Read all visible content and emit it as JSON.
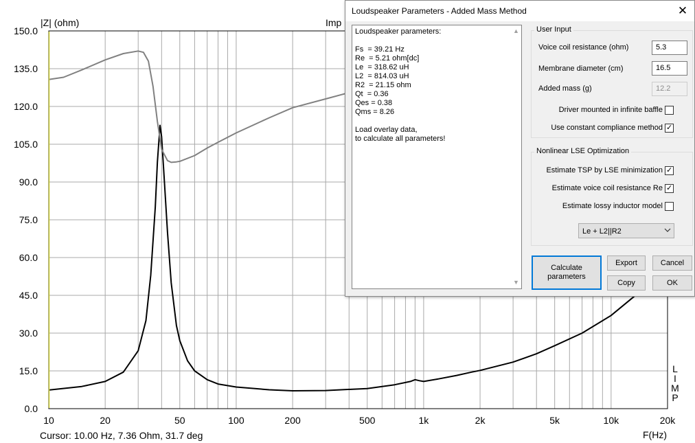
{
  "chart_data": {
    "type": "line",
    "ylabel": "|Z| (ohm)",
    "title_visible": "Imp",
    "xlabel": "F(Hz)",
    "x_scale": "log",
    "xlim": [
      10,
      20000
    ],
    "ylim": [
      0,
      150
    ],
    "x_ticks": [
      {
        "v": 10,
        "label": "10"
      },
      {
        "v": 20,
        "label": "20"
      },
      {
        "v": 50,
        "label": "50"
      },
      {
        "v": 100,
        "label": "100"
      },
      {
        "v": 200,
        "label": "200"
      },
      {
        "v": 500,
        "label": "500"
      },
      {
        "v": 1000,
        "label": "1k"
      },
      {
        "v": 2000,
        "label": "2k"
      },
      {
        "v": 5000,
        "label": "5k"
      },
      {
        "v": 10000,
        "label": "10k"
      },
      {
        "v": 20000,
        "label": "20k"
      }
    ],
    "y_ticks": [
      "0.0",
      "15.0",
      "30.0",
      "45.0",
      "60.0",
      "75.0",
      "90.0",
      "105.0",
      "120.0",
      "135.0",
      "150.0"
    ],
    "grid": true,
    "cursor_x": 10,
    "right_label": [
      "L",
      "I",
      "M",
      "P"
    ],
    "series": [
      {
        "color": "#000000",
        "x": [
          10,
          15,
          20,
          25,
          30,
          33,
          35,
          37,
          38,
          39.21,
          40,
          41,
          43,
          45,
          48,
          50,
          55,
          60,
          70,
          80,
          100,
          150,
          200,
          300,
          500,
          700,
          850,
          900,
          950,
          1000,
          1200,
          1500,
          1800,
          2000,
          3000,
          4000,
          5000,
          7000,
          10000,
          13000,
          14000,
          15000
        ],
        "y": [
          7.4,
          8.8,
          10.8,
          14.5,
          23,
          35,
          53,
          80,
          98,
          112.5,
          108,
          95,
          70,
          50,
          33,
          27,
          19,
          15,
          11.5,
          9.8,
          8.6,
          7.5,
          7.1,
          7.2,
          8,
          9.5,
          10.8,
          11.5,
          11.1,
          10.8,
          11.8,
          13.2,
          14.5,
          15.2,
          18.5,
          21.8,
          25,
          30,
          37,
          44,
          46,
          48
        ]
      },
      {
        "color": "#808080",
        "x": [
          10,
          12,
          15,
          20,
          25,
          30,
          32,
          34,
          36,
          38,
          40,
          43,
          45,
          48,
          50,
          60,
          70,
          80,
          100,
          150,
          200,
          300,
          400,
          500
        ],
        "y": [
          130.7,
          131.6,
          134.5,
          138.5,
          141,
          142,
          141.5,
          138,
          128,
          114,
          103,
          98.5,
          97.8,
          98,
          98.2,
          100.5,
          103.5,
          105.8,
          109.5,
          115.5,
          119.5,
          123,
          125.5,
          127.2
        ]
      }
    ]
  },
  "status": {
    "cursor_readout": "Cursor: 10.00 Hz, 7.36 Ohm, 31.7 deg"
  },
  "dialog": {
    "title": "Loudspeaker Parameters - Added Mass Method",
    "close_glyph": "✕",
    "results_lines": [
      "Loudspeaker parameters:",
      "",
      "Fs  = 39.21 Hz",
      "Re  = 5.21 ohm[dc]",
      "Le  = 318.62 uH",
      "L2  = 814.03 uH",
      "R2  = 21.15 ohm",
      "Qt  = 0.36",
      "Qes = 0.38",
      "Qms = 8.26",
      "",
      "Load overlay data,",
      "to calculate all parameters!"
    ],
    "user_input": {
      "group_label": "User Input",
      "voice_coil_label": "Voice coil resistance (ohm)",
      "voice_coil_value": "5.3",
      "membrane_label": "Membrane diameter (cm)",
      "membrane_value": "16.5",
      "added_mass_label": "Added mass (g)",
      "added_mass_value": "12.2",
      "infinite_baffle_label": "Driver mounted in infinite baffle",
      "infinite_baffle_checked": false,
      "constant_compliance_label": "Use constant compliance method",
      "constant_compliance_checked": true
    },
    "nonlinear": {
      "group_label": "Nonlinear LSE Optimization",
      "estimate_tsp_label": "Estimate TSP by LSE minimization",
      "estimate_tsp_checked": true,
      "estimate_re_label": "Estimate voice coil resistance Re",
      "estimate_re_checked": true,
      "lossy_inductor_label": "Estimate lossy inductor model",
      "lossy_inductor_checked": false,
      "model_value": "Le + L2||R2"
    },
    "buttons": {
      "calculate": "Calculate parameters",
      "export": "Export",
      "cancel": "Cancel",
      "copy": "Copy",
      "ok": "OK"
    },
    "check_glyph": "✓"
  },
  "colors": {
    "cursor_line": "#c8c832",
    "grid": "#a8a8a8",
    "focus_border": "#0078d7"
  }
}
